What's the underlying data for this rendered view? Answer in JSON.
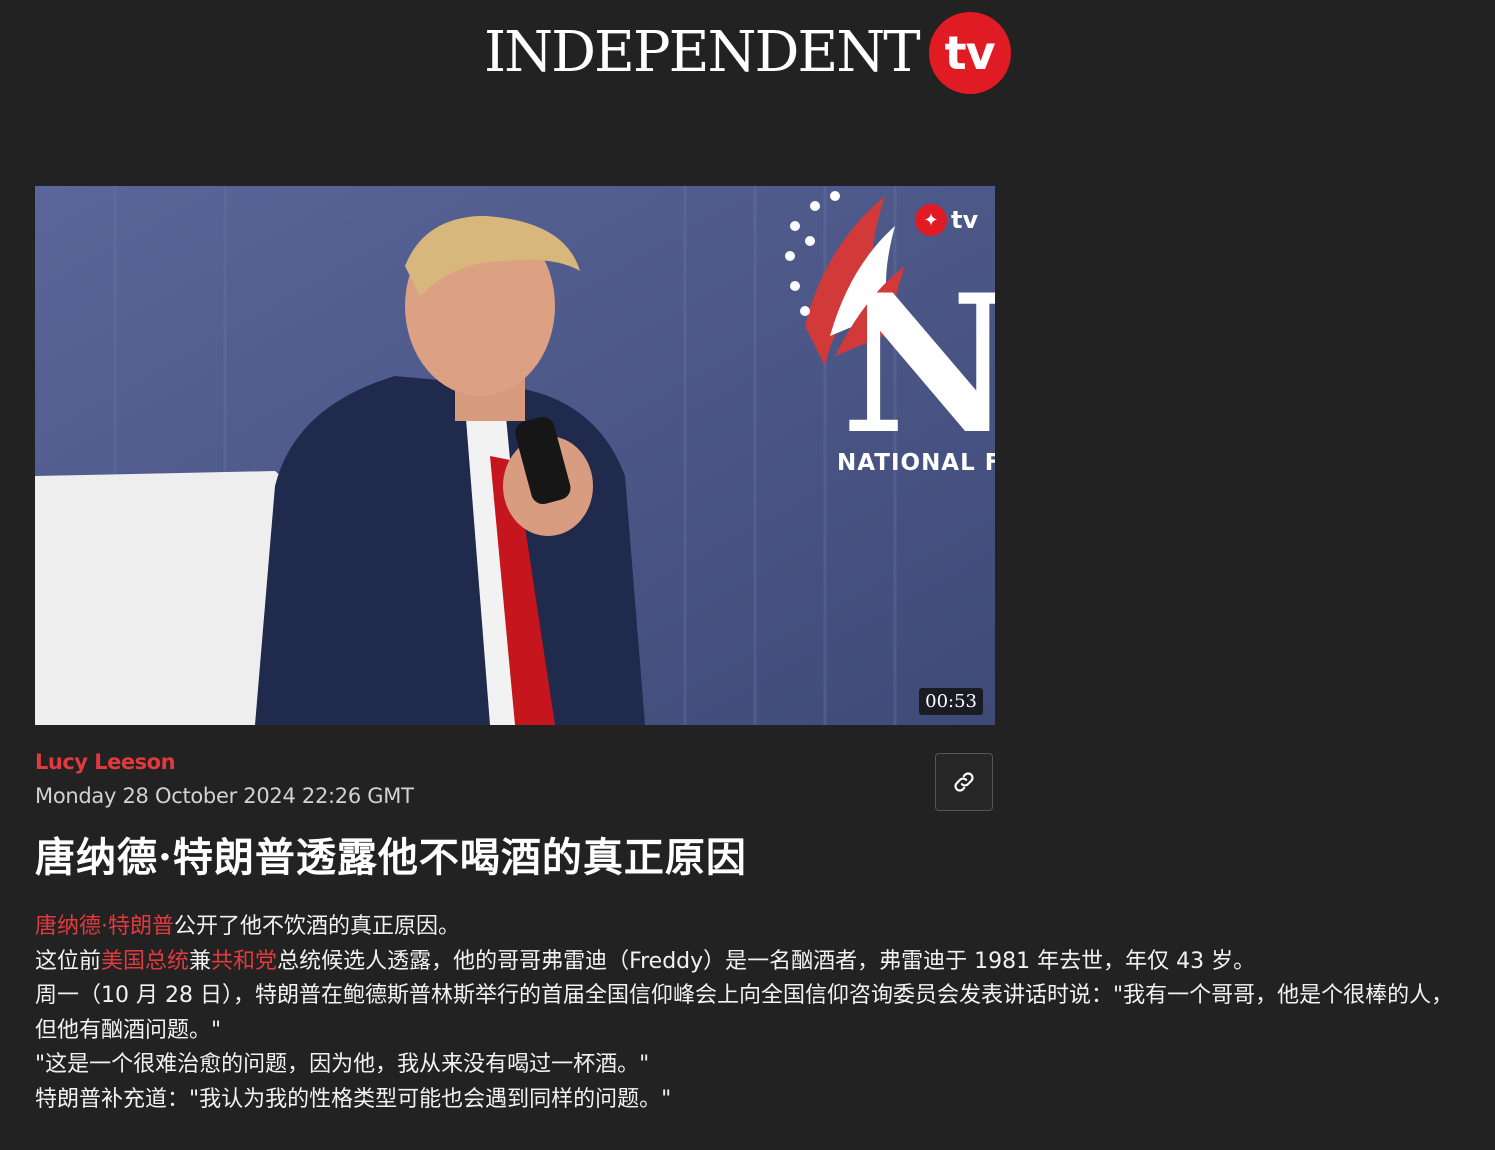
{
  "brand": {
    "wordmark": "INDEPENDENT",
    "tv": "tv"
  },
  "video": {
    "duration": "00:53",
    "watermark": "tv",
    "backdrop_text": "NI",
    "backdrop_label": "NATIONAL FA"
  },
  "article": {
    "author": "Lucy Leeson",
    "date": "Monday 28 October 2024 22:26 GMT",
    "headline": "唐纳德·特朗普透露他不喝酒的真正原因",
    "p1": {
      "link": "唐纳德·特朗普",
      "rest": "公开了他不饮酒的真正原因。"
    },
    "p2": {
      "a": "这位前",
      "link1": "美国总统",
      "b": "兼",
      "link2": "共和党",
      "c": "总统候选人透露，他的哥哥弗雷迪（Freddy）是一名酗酒者，弗雷迪于 1981 年去世，年仅 43 岁。"
    },
    "p3": "周一（10 月 28 日），特朗普在鲍德斯普林斯举行的首届全国信仰峰会上向全国信仰咨询委员会发表讲话时说：\"我有一个哥哥，他是个很棒的人，但他有酗酒问题。\"",
    "p4": "\"这是一个很难治愈的问题，因为他，我从来没有喝过一杯酒。\"",
    "p5": "特朗普补充道：\"我认为我的性格类型可能也会遇到同样的问题。\""
  },
  "icons": {
    "link": "link-icon",
    "watermark": "eagle-icon"
  },
  "colors": {
    "background": "#222222",
    "accent": "#e0393e",
    "brand_red": "#e01b24"
  }
}
